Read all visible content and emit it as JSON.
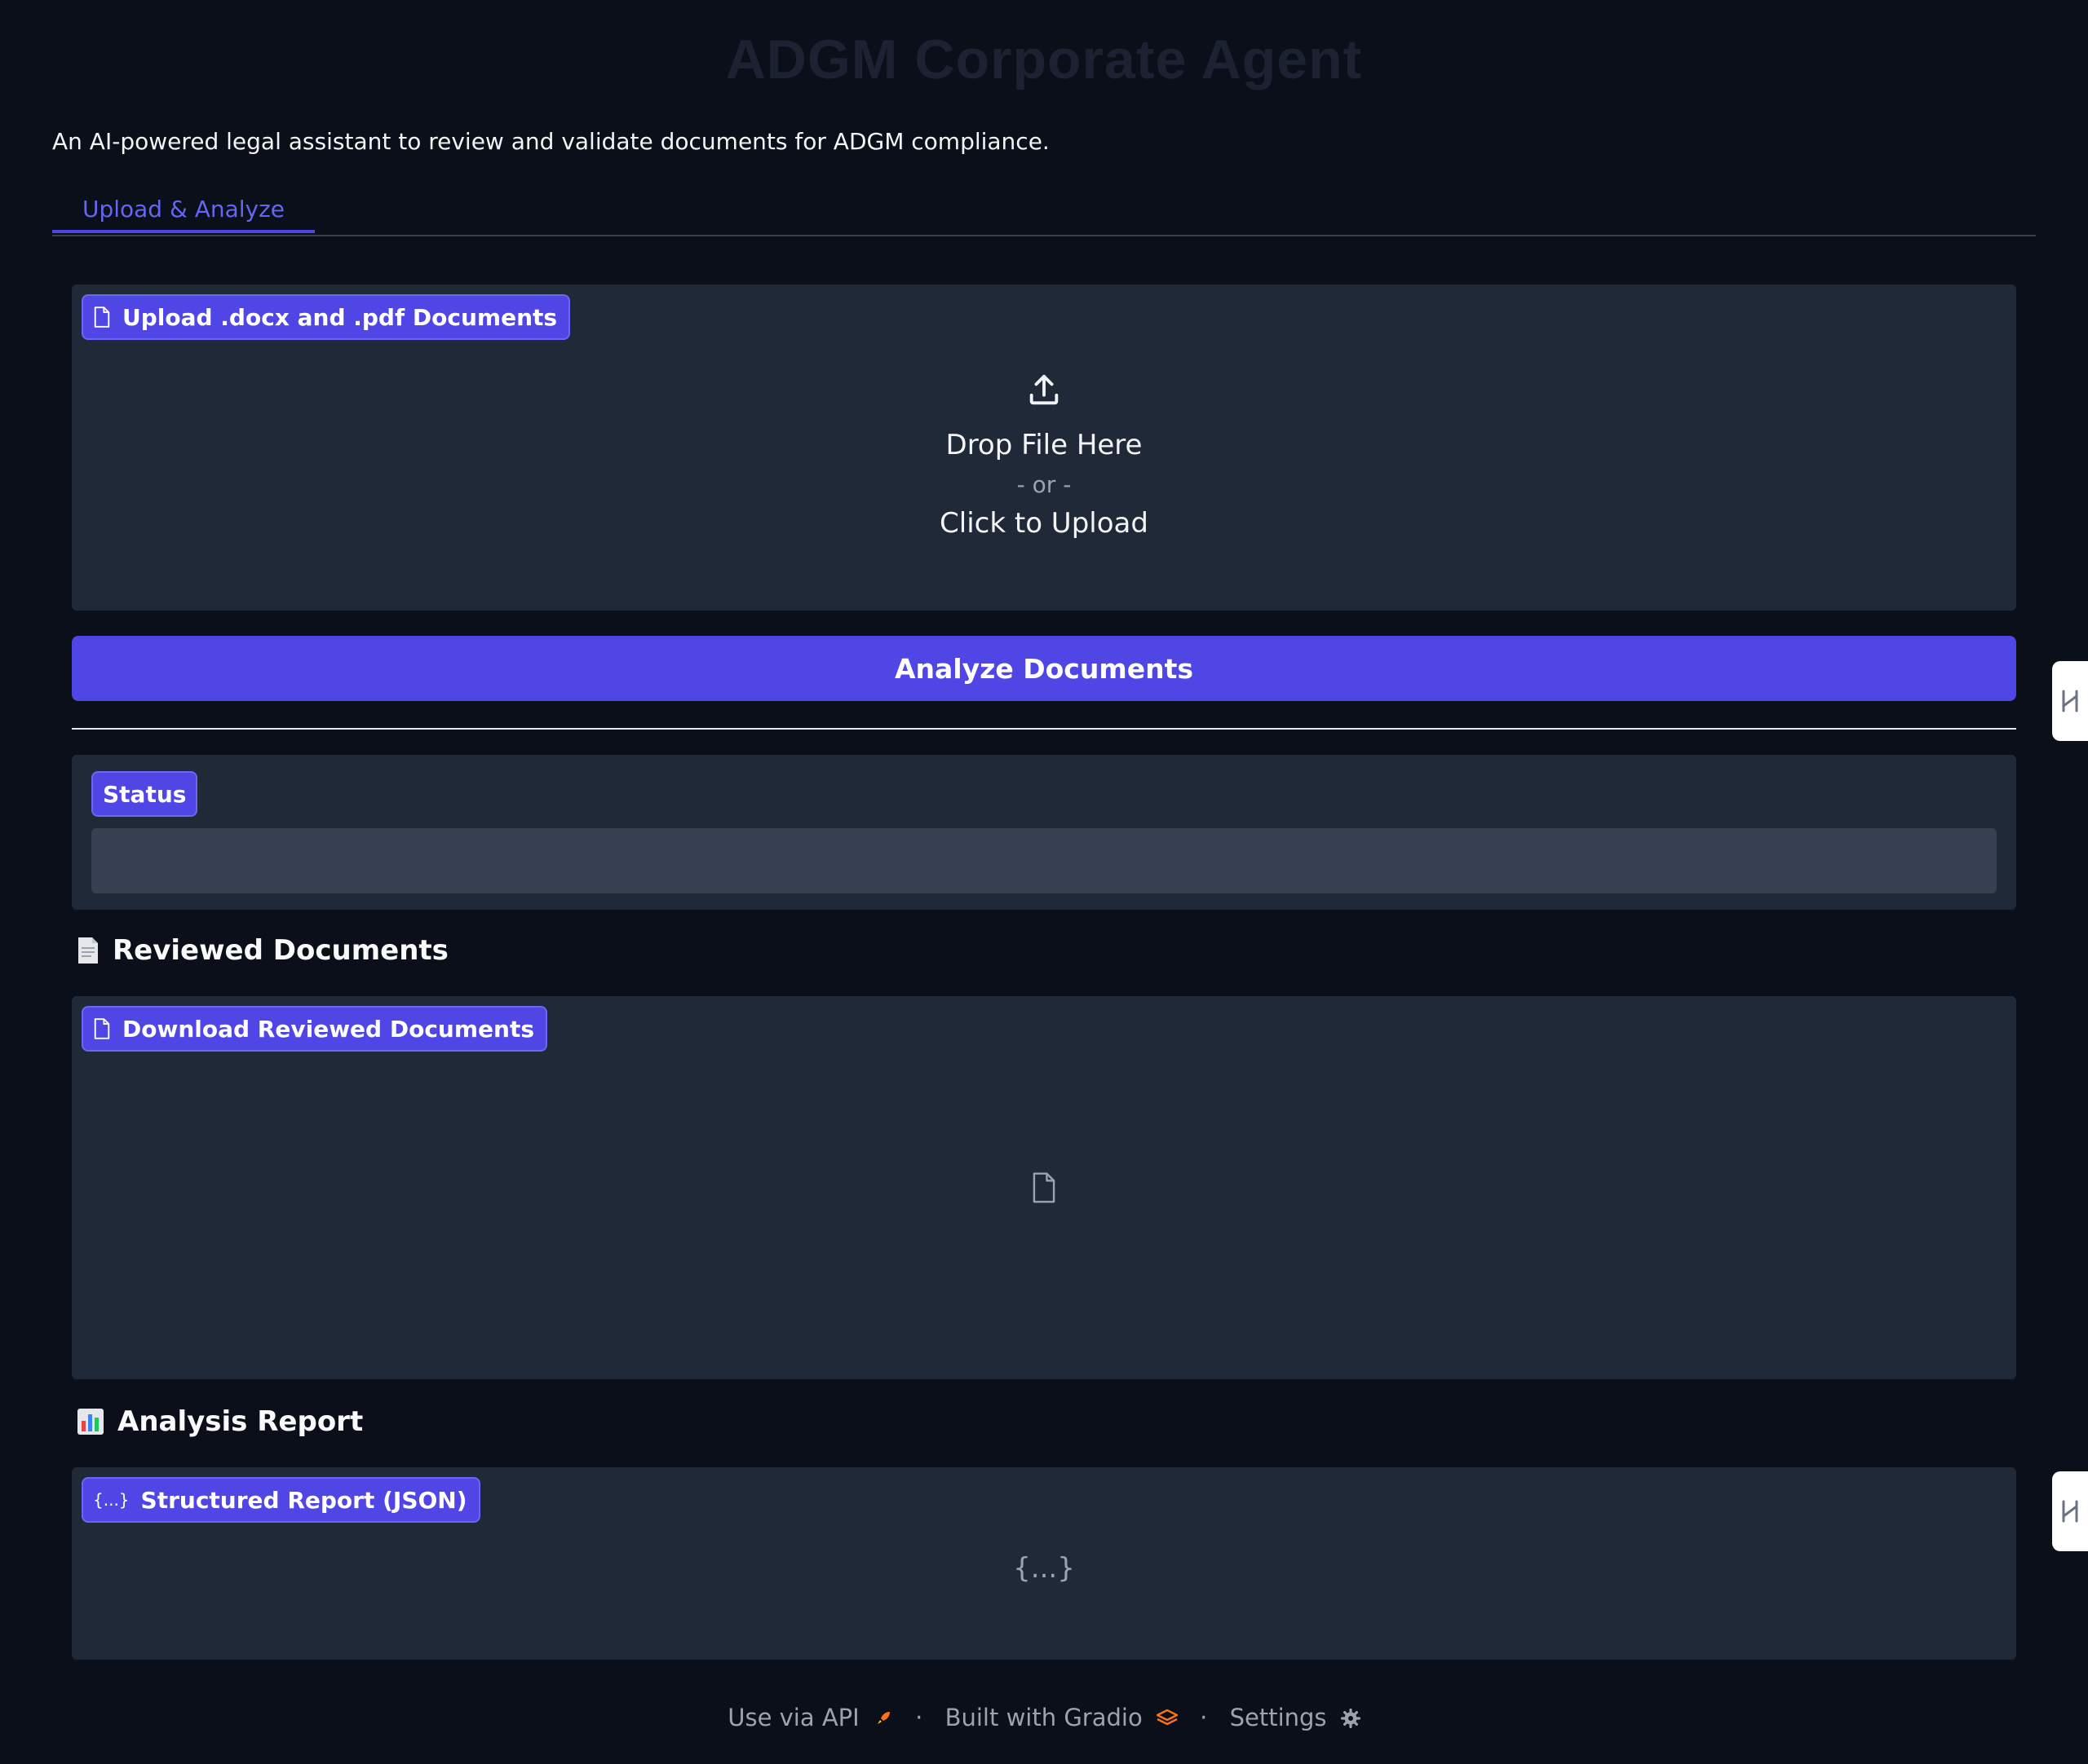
{
  "app": {
    "title": "ADGM Corporate Agent",
    "subtitle": "An AI-powered legal assistant to review and validate documents for ADGM compliance."
  },
  "tabs": [
    {
      "label": "Upload & Analyze",
      "active": true
    }
  ],
  "upload": {
    "label": "Upload .docx and .pdf Documents",
    "drop_text": "Drop File Here",
    "or_text": "- or -",
    "click_text": "Click to Upload"
  },
  "analyze_button": {
    "label": "Analyze Documents"
  },
  "status": {
    "label": "Status",
    "value": ""
  },
  "reviewed": {
    "heading": "Reviewed Documents",
    "heading_icon": "page-icon",
    "download_label": "Download Reviewed Documents"
  },
  "report": {
    "heading": "Analysis Report",
    "heading_icon": "bar-chart-icon",
    "json_label": "Structured Report (JSON)",
    "empty_glyph": "{...}"
  },
  "footer": {
    "api": "Use via API",
    "built": "Built with Gradio",
    "settings": "Settings",
    "separator": "·"
  },
  "colors": {
    "background": "#0b0f19",
    "panel": "#1f2937",
    "accent": "#4f46e5",
    "input": "#374151"
  }
}
